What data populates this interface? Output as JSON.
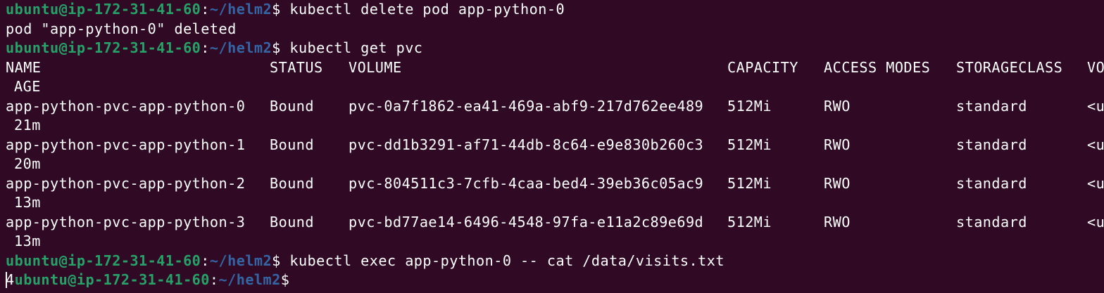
{
  "prompt": {
    "user_host": "ubuntu@ip-172-31-41-60",
    "colon": ":",
    "path": "~/helm2",
    "dollar": "$"
  },
  "commands": [
    " kubectl delete pod app-python-0",
    " kubectl get pvc",
    " kubectl exec app-python-0 -- cat /data/visits.txt"
  ],
  "delete_output": "pod \"app-python-0\" deleted",
  "pvc_table": {
    "headers": [
      "NAME",
      "STATUS",
      "VOLUME",
      "CAPACITY",
      "ACCESS MODES",
      "STORAGECLASS",
      "VO"
    ],
    "wrapped_header": "AGE",
    "rows": [
      {
        "name": "app-python-pvc-app-python-0",
        "status": "Bound",
        "volume": "pvc-0a7f1862-ea41-469a-abf9-217d762ee489",
        "capacity": "512Mi",
        "access_modes": "RWO",
        "storageclass": "standard",
        "vo": "<u",
        "age": "21m"
      },
      {
        "name": "app-python-pvc-app-python-1",
        "status": "Bound",
        "volume": "pvc-dd1b3291-af71-44db-8c64-e9e830b260c3",
        "capacity": "512Mi",
        "access_modes": "RWO",
        "storageclass": "standard",
        "vo": "<u",
        "age": "20m"
      },
      {
        "name": "app-python-pvc-app-python-2",
        "status": "Bound",
        "volume": "pvc-804511c3-7cfb-4caa-bed4-39eb36c05ac9",
        "capacity": "512Mi",
        "access_modes": "RWO",
        "storageclass": "standard",
        "vo": "<u",
        "age": "13m"
      },
      {
        "name": "app-python-pvc-app-python-3",
        "status": "Bound",
        "volume": "pvc-bd77ae14-6496-4548-97fa-e11a2c89e69d",
        "capacity": "512Mi",
        "access_modes": "RWO",
        "storageclass": "standard",
        "vo": "<u",
        "age": "13m"
      }
    ]
  },
  "exec_output": "4",
  "colors": {
    "background": "#300a24",
    "prompt_user": "#26a269",
    "prompt_path": "#3465a4",
    "text": "#ffffff"
  }
}
